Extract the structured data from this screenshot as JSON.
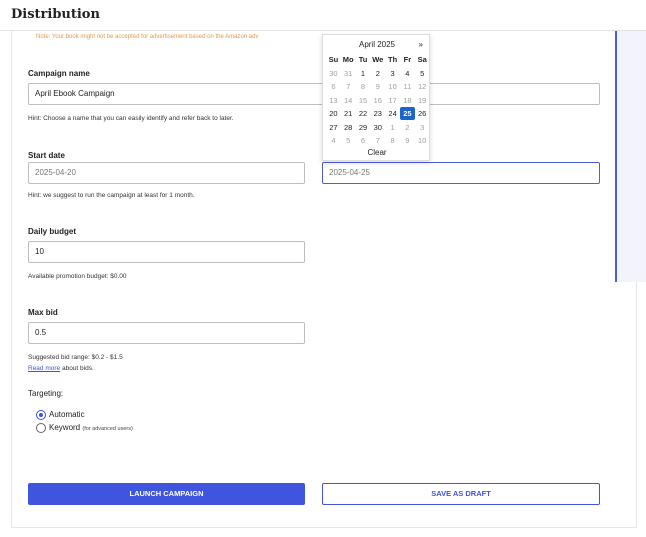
{
  "header": {
    "title": "Distribution"
  },
  "note": "Note: Your book might not be accepted for advertisement based on the Amazon adv",
  "campaign": {
    "label": "Campaign name",
    "value": "April Ebook Campaign",
    "hint": "Hint: Choose a name that you can easily identify and refer back to later."
  },
  "dates": {
    "label": "Start date",
    "start_value": "2025-04-20",
    "end_value": "2025-04-25",
    "hint": "Hint: we suggest to run the campaign at least for 1 month."
  },
  "budget": {
    "label": "Daily budget",
    "value": "10",
    "hint": "Available promotion budget: $0.00"
  },
  "bid": {
    "label": "Max bid",
    "value": "0.5",
    "hint": "Suggested bid range: $0.2 - $1.5",
    "read_more": "Read more",
    "read_more_suffix": " about bids."
  },
  "targeting": {
    "label": "Targeting:",
    "options": [
      {
        "label": "Automatic",
        "sub": "",
        "selected": true
      },
      {
        "label": "Keyword",
        "sub": "(for advanced users)",
        "selected": false
      }
    ]
  },
  "actions": {
    "launch": "LAUNCH CAMPAIGN",
    "draft": "SAVE AS DRAFT"
  },
  "datepicker": {
    "month": "April 2025",
    "next": "»",
    "weekdays": [
      "Su",
      "Mo",
      "Tu",
      "We",
      "Th",
      "Fr",
      "Sa"
    ],
    "weeks": [
      [
        "30",
        "31",
        "1",
        "2",
        "3",
        "4",
        "5"
      ],
      [
        "6",
        "7",
        "8",
        "9",
        "10",
        "11",
        "12"
      ],
      [
        "13",
        "14",
        "15",
        "16",
        "17",
        "18",
        "19"
      ],
      [
        "20",
        "21",
        "22",
        "23",
        "24",
        "25",
        "26"
      ],
      [
        "27",
        "28",
        "29",
        "30",
        "1",
        "2",
        "3"
      ],
      [
        "4",
        "5",
        "6",
        "7",
        "8",
        "9",
        "10"
      ]
    ],
    "selected": "25",
    "clear": "Clear"
  },
  "colors": {
    "accent": "#3f55dd",
    "selected_day": "#1d64c8",
    "note": "#e39a4f"
  }
}
